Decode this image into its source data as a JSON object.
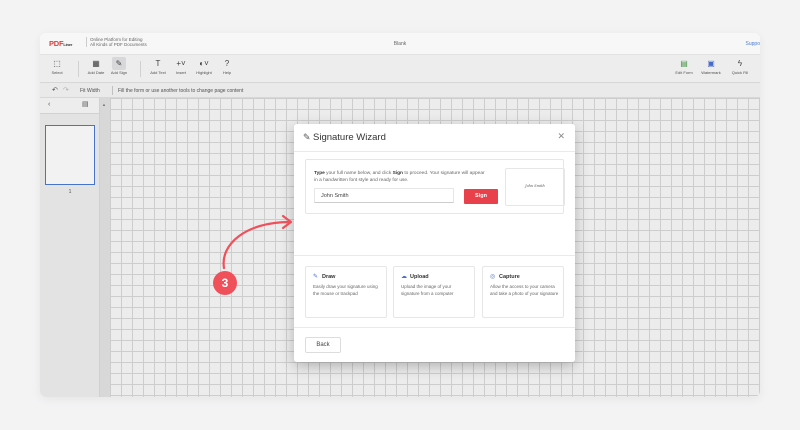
{
  "titlebar": {
    "logo_main": "PDF",
    "logo_sub": "Liner",
    "tagline_1": "Online Platform for Editing",
    "tagline_2": "All Kinds of PDF Documents",
    "doc_title": "Blank",
    "support": "Suppo"
  },
  "toolbar": {
    "select": "Select",
    "add_date": "Add Date",
    "add_sign": "Add Sign",
    "add_text": "Add Text",
    "insert": "Insert",
    "highlight": "Highlight",
    "help": "Help",
    "edit_form": "Edit Form",
    "watermark": "Watermark",
    "quick_fill": "Quick Fill"
  },
  "subbar": {
    "fit_width": "Fit Width",
    "hint": "Fill the form or use another tools to change page content"
  },
  "left_panel": {
    "page_number": "1"
  },
  "modal": {
    "title": "Signature Wizard",
    "desc_bold_1": "Type",
    "desc_part_1": " your full name below, and click ",
    "desc_bold_2": "Sign",
    "desc_part_2": " to proceed. Your signature will appear in a handwritten font style and ready for use.",
    "name_value": "John Smith",
    "sign_button": "Sign",
    "preview_signature": "John Smith",
    "options": [
      {
        "title": "Draw",
        "desc": "Easily draw your signature using the mouse or trackpad"
      },
      {
        "title": "Upload",
        "desc": "Upload the image of your signature from a computer"
      },
      {
        "title": "Capture",
        "desc": "Allow the access to your camera and take a photo of your signature"
      }
    ],
    "back_button": "Back"
  },
  "annotation": {
    "step_number": "3",
    "color": "#f0505a"
  },
  "colors": {
    "accent_red": "#e8414c",
    "accent_blue": "#4a6fd6",
    "selection_blue": "#4a7bd6"
  }
}
